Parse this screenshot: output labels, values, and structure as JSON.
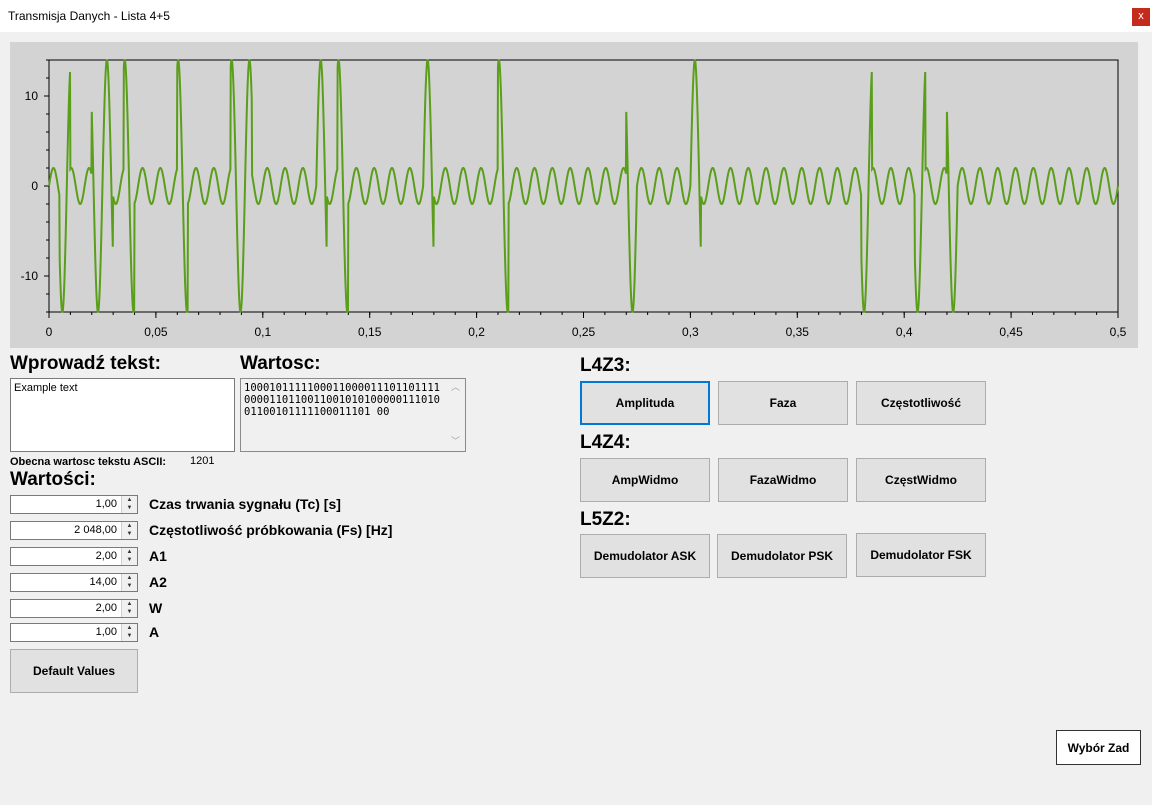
{
  "window": {
    "title": "Transmisja Danych - Lista 4+5",
    "close_label": "x"
  },
  "left": {
    "input_heading": "Wprowadź tekst:",
    "input_value": "Example text",
    "binary_heading": "Wartosc:",
    "binary_value": "1000101111100011000011101101111000011011001100101010000011101001100101111100011101 00",
    "ascii_label": "Obecna wartosc tekstu ASCII:",
    "ascii_value": "1201",
    "values_heading": "Wartości:",
    "params": [
      {
        "value": "1,00",
        "label": "Czas trwania sygnału (Tc) [s]"
      },
      {
        "value": "2 048,00",
        "label": "Częstotliwość próbkowania (Fs) [Hz]"
      },
      {
        "value": "2,00",
        "label": "A1"
      },
      {
        "value": "14,00",
        "label": "A2"
      },
      {
        "value": "2,00",
        "label": "W"
      },
      {
        "value": "1,00",
        "label": "A"
      }
    ],
    "default_button": "Default Values"
  },
  "right": {
    "l4z3_heading": "L4Z3:",
    "l4z3_buttons": [
      "Amplituda",
      "Faza",
      "Częstotliwość"
    ],
    "l4z4_heading": "L4Z4:",
    "l4z4_buttons": [
      "AmpWidmo",
      "FazaWidmo",
      "CzęstWidmo"
    ],
    "l5z2_heading": "L5Z2:",
    "l5z2_buttons": [
      "Demudolator ASK",
      "Demudolator PSK",
      "Demudolator FSK"
    ],
    "select_button": "Wybór Zad"
  },
  "chart_data": {
    "type": "line",
    "title": "",
    "xlabel": "",
    "ylabel": "",
    "xlim": [
      0,
      0.5
    ],
    "ylim": [
      -14,
      14
    ],
    "x_ticks": [
      "0",
      "0,05",
      "0,1",
      "0,15",
      "0,2",
      "0,25",
      "0,3",
      "0,35",
      "0,4",
      "0,45",
      "0,5"
    ],
    "y_ticks": [
      "10",
      "0",
      "-10"
    ],
    "y_tick_values": [
      10,
      0,
      -10
    ],
    "grid": false,
    "series": [
      {
        "color": "#5a9e1a",
        "signal": "ASK",
        "carrier_freq_hz": 120,
        "bit_duration_s": 0.005,
        "amplitude_bit1": 14,
        "amplitude_bit0": 2,
        "bits": "01001101000010000110000001010000000100000010000000000010000010000000000000001000010010000000"
      }
    ]
  }
}
